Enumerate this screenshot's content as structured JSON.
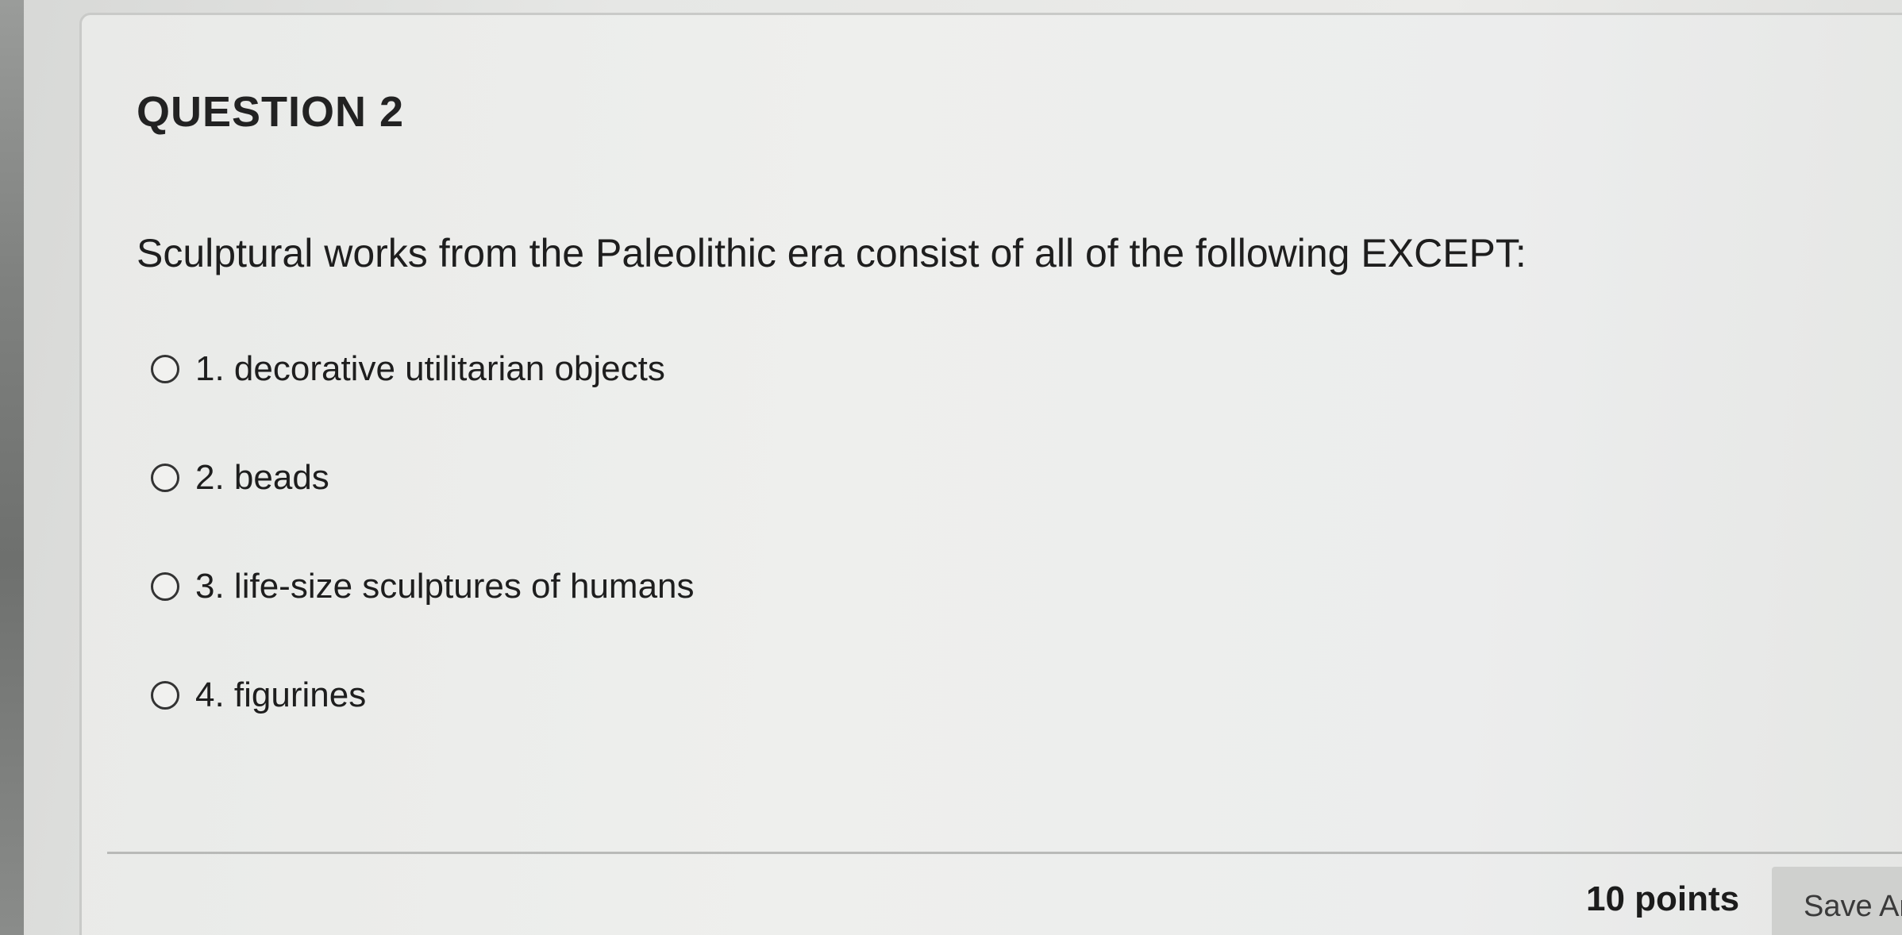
{
  "question": {
    "title": "QUESTION 2",
    "text": "Sculptural works from the Paleolithic era consist of all of the following EXCEPT:",
    "options": [
      {
        "label": "1. decorative utilitarian objects",
        "selected": false
      },
      {
        "label": "2. beads",
        "selected": false
      },
      {
        "label": "3. life-size sculptures of humans",
        "selected": false
      },
      {
        "label": "4. figurines",
        "selected": false
      }
    ]
  },
  "footer": {
    "points": "10 points",
    "save_label": "Save An"
  }
}
